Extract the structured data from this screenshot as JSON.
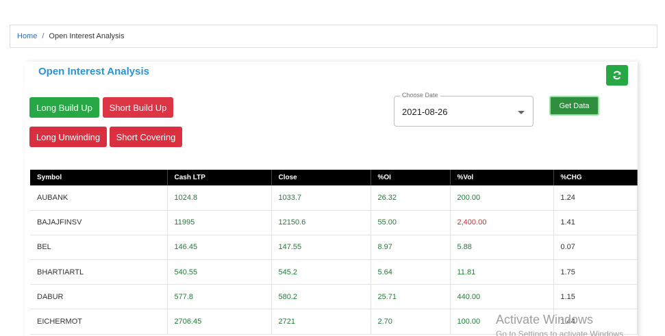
{
  "breadcrumb": {
    "home": "Home",
    "separator": "/",
    "current": "Open Interest Analysis"
  },
  "page": {
    "title": "Open Interest Analysis"
  },
  "filters": {
    "long_build_up": "Long Build Up",
    "short_build_up": "Short Build Up",
    "long_unwinding": "Long Unwinding",
    "short_covering": "Short Covering"
  },
  "date_picker": {
    "label": "Choose Date",
    "value": "2021-08-26"
  },
  "get_data": "Get Data",
  "refresh_icon": "refresh-icon",
  "table": {
    "headers": [
      "Symbol",
      "Cash LTP",
      "Close",
      "%OI",
      "%Vol",
      "%CHG"
    ],
    "rows": [
      [
        "AUBANK",
        "1024.8",
        "1033.7",
        "26.32",
        "200.00",
        "1.24"
      ],
      [
        "BAJAJFINSV",
        "11995",
        "12150.6",
        "55.00",
        "2,400.00",
        "1.41"
      ],
      [
        "BEL",
        "146.45",
        "147.55",
        "8.97",
        "5.88",
        "0.07"
      ],
      [
        "BHARTIARTL",
        "540.55",
        "545.2",
        "5.64",
        "11.81",
        "1.75"
      ],
      [
        "DABUR",
        "577.8",
        "580.2",
        "25.71",
        "440.00",
        "1.15"
      ],
      [
        "EICHERMOT",
        "2706.45",
        "2721",
        "2.70",
        "100.00",
        "1.44"
      ]
    ]
  },
  "watermark": {
    "title": "Activate Windows",
    "subtitle": "Go to Settings to activate Windows."
  },
  "colors": {
    "title": "#2a93d5",
    "green": "#28a745",
    "red": "#dc3545",
    "positive_text": "#1e7e34",
    "negative_text": "#d9262f"
  }
}
